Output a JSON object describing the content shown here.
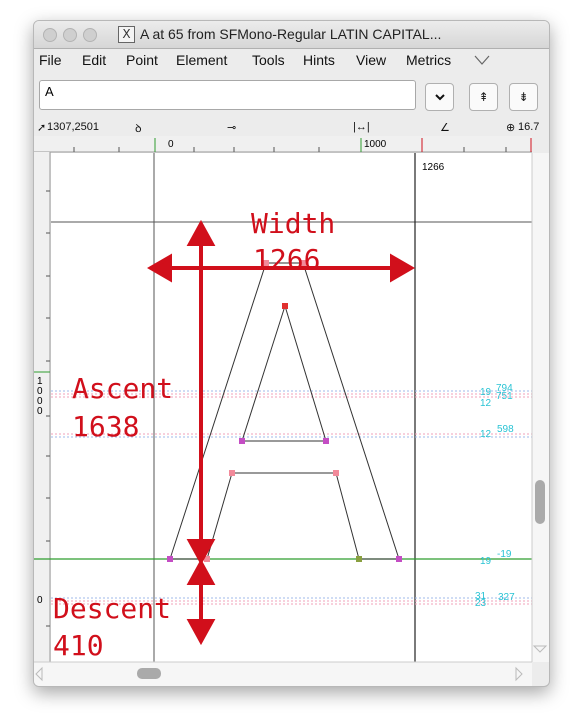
{
  "window": {
    "title": "A at 65 from SFMono-Regular LATIN CAPITAL...",
    "title_icon": "x11-icon"
  },
  "menu": [
    "File",
    "Edit",
    "Point",
    "Element",
    "Tools",
    "Hints",
    "View",
    "Metrics"
  ],
  "glyph_input": {
    "value": "A"
  },
  "toolbar": {
    "icons": [
      "chevron-down-icon",
      "hint-up-icon",
      "hint-double-icon"
    ]
  },
  "infobar": {
    "coords": "1307,2501",
    "zoom": "16.7"
  },
  "rulers": {
    "top_0": "0",
    "top_1000": "1000",
    "top_1266": "1266",
    "left_1000": [
      "1",
      "0",
      "0",
      "0"
    ],
    "left_0": "0"
  },
  "metrics": {
    "right_794": "794",
    "right_751": "751",
    "right_19a": "19",
    "right_12a": "12",
    "right_598": "598",
    "right_12b": "12",
    "right_19b": "19",
    "right_m19": "-19",
    "right_31": "31",
    "right_23": "23",
    "right_327": "327"
  },
  "annotations": {
    "width_label": "Width",
    "width_value": "1266",
    "ascent_label": "Ascent",
    "ascent_value": "1638",
    "descent_label": "Descent",
    "descent_value": "410"
  },
  "colors": {
    "annotation_red": "#d10f1b",
    "metrics_cyan": "#28c3d4",
    "guide_pink": "#f2a0b8",
    "guide_blue": "#9fb8ea",
    "point_pink": "#f28a9a",
    "point_magenta": "#c44dc4"
  }
}
